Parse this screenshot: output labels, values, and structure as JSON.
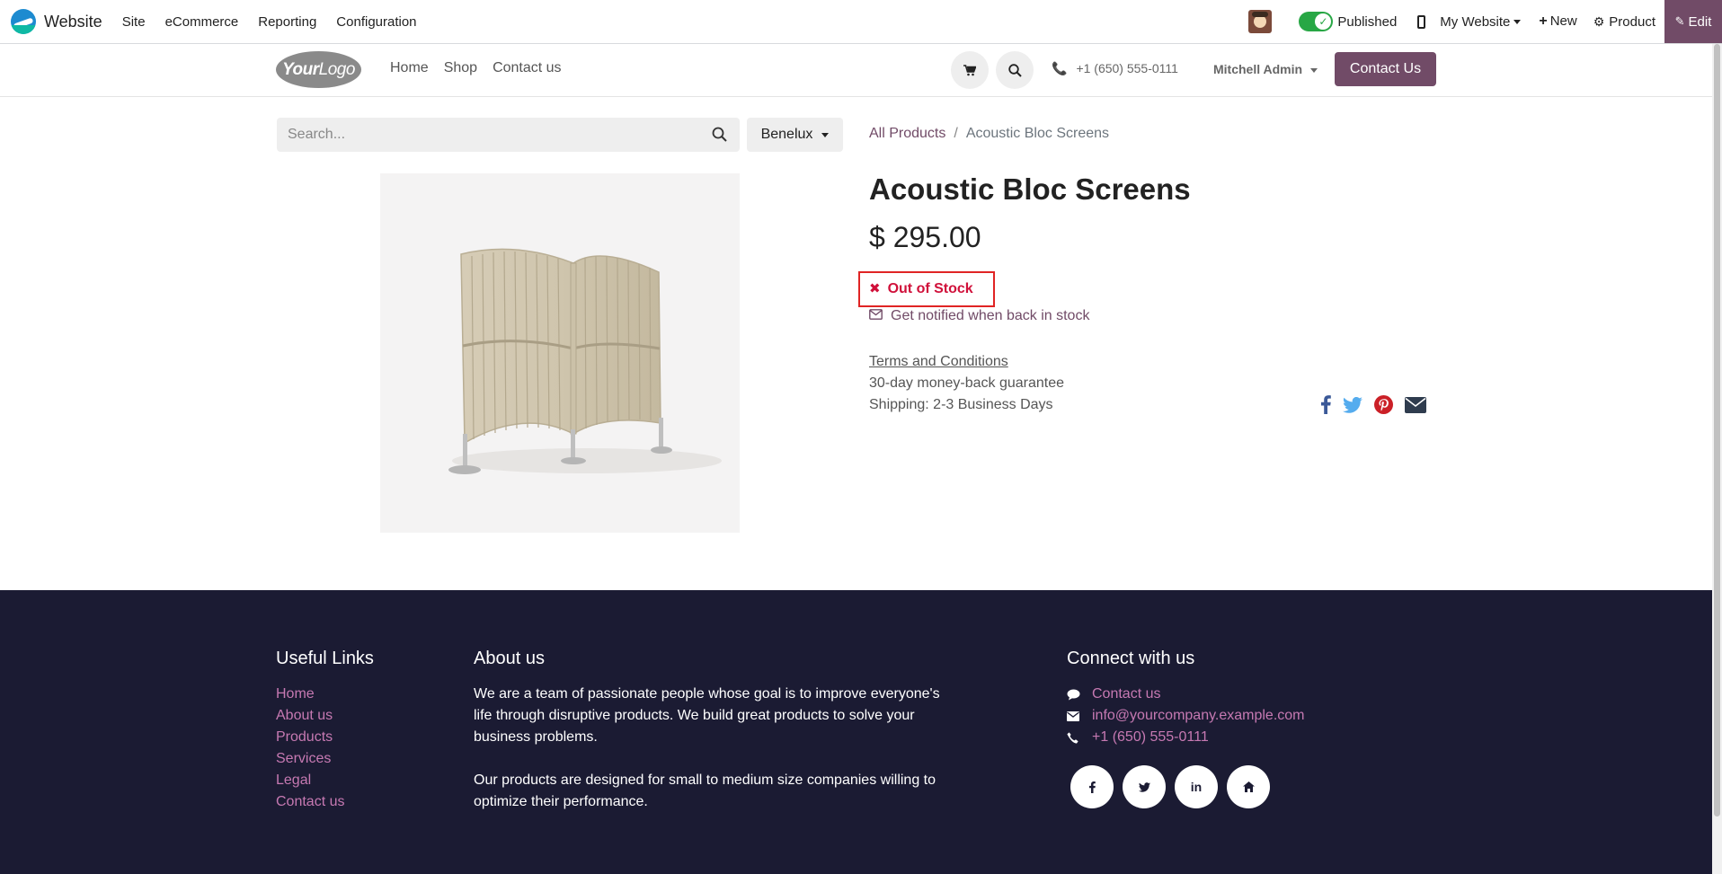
{
  "admin_bar": {
    "app_name": "Website",
    "menu": [
      "Site",
      "eCommerce",
      "Reporting",
      "Configuration"
    ],
    "published_label": "Published",
    "website_switcher": "My Website",
    "new_label": "New",
    "product_label": "Product",
    "edit_label": "Edit"
  },
  "header": {
    "logo_text_bold": "Your",
    "logo_text": "Logo",
    "nav": [
      "Home",
      "Shop",
      "Contact us"
    ],
    "phone": "+1 (650) 555-0111",
    "user": "Mitchell Admin",
    "cta_label": "Contact Us"
  },
  "search": {
    "placeholder": "Search...",
    "pricelist": "Benelux"
  },
  "breadcrumb": {
    "parent": "All Products",
    "separator": "/",
    "current": "Acoustic Bloc Screens"
  },
  "product": {
    "name": "Acoustic Bloc Screens",
    "price": "$ 295.00",
    "stock_status": "Out of Stock",
    "notify_label": "Get notified when back in stock",
    "terms_label": "Terms and Conditions",
    "guarantee": "30-day money-back guarantee",
    "shipping": "Shipping: 2-3 Business Days"
  },
  "share_icons": [
    "facebook-icon",
    "twitter-icon",
    "pinterest-icon",
    "envelope-icon"
  ],
  "footer": {
    "useful_links_title": "Useful Links",
    "useful_links": [
      "Home",
      "About us",
      "Products",
      "Services",
      "Legal",
      "Contact us"
    ],
    "about_title": "About us",
    "about_p1": "We are a team of passionate people whose goal is to improve everyone's life through disruptive products. We build great products to solve your business problems.",
    "about_p2": "Our products are designed for small to medium size companies willing to optimize their performance.",
    "connect_title": "Connect with us",
    "connect_contact": "Contact us",
    "connect_email": "info@yourcompany.example.com",
    "connect_phone": "+1 (650) 555-0111",
    "social_icons": [
      "facebook-icon",
      "twitter-icon",
      "linkedin-icon",
      "home-icon"
    ]
  },
  "colors": {
    "brand": "#714b67",
    "footer_bg": "#1b1b33",
    "footer_link": "#c679b2",
    "out_of_stock": "#d0103a",
    "published_toggle": "#28a745"
  }
}
